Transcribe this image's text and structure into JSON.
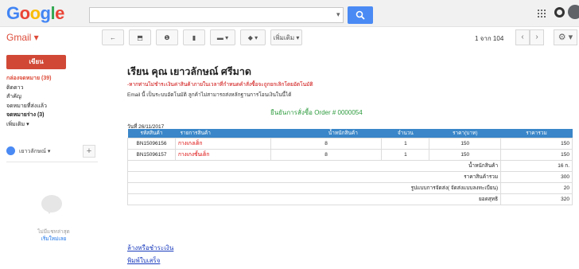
{
  "logo": {
    "letters": [
      "G",
      "o",
      "o",
      "g",
      "l",
      "e"
    ],
    "colors": [
      "#4285f4",
      "#ea4335",
      "#fbbc05",
      "#4285f4",
      "#34a853",
      "#ea4335"
    ]
  },
  "header": {
    "search_value": ""
  },
  "gmail_label": "Gmail ▾",
  "toolbar": {
    "buttons": [
      "←",
      "⬒",
      "❶",
      "▮",
      "▬ ▾",
      "◆ ▾",
      "เพิ่มเติม ▾"
    ]
  },
  "pager": {
    "text": "1 จาก 104",
    "prev": "‹",
    "next": "›",
    "settings": "⚙ ▾"
  },
  "sidebar": {
    "compose": "เขียน",
    "items": [
      {
        "label": "กล่องจดหมาย (39)",
        "state": "active"
      },
      {
        "label": "ติดดาว",
        "state": "normal"
      },
      {
        "label": "สำคัญ",
        "state": "normal"
      },
      {
        "label": "จดหมายที่ส่งแล้ว",
        "state": "normal"
      },
      {
        "label": "จดหมายร่าง (3)",
        "state": "bold"
      },
      {
        "label": "เพิ่มเติม ▾",
        "state": "normal"
      }
    ],
    "hangout_user": "เยาวลักษณ์ ▾",
    "hangout_text": "ไม่มีแชทล่าสุด",
    "hangout_link": "เริ่มใหม่เลย"
  },
  "email": {
    "subject": "เรียน คุณ เยาวลักษณ์ ศรีมาด",
    "notice": "-หากท่านไม่ชำระเงินค่าสินค้าภายในเวลาที่กำหนดคำสั่งซื้อจะถูกยกเลิกโดยอัตโนมัติ",
    "email_line": "Email นี้ เป็นระบบอัตโนมัติ ลูกค้าไม่สามารถส่งหลักฐานการโอนเงินในนี้ได้",
    "confirm": "ยืนยันการสั่งซื้อ Order # 0000054",
    "date": "วันที่ 26/11/2017"
  },
  "table": {
    "headers": [
      "รหัสสินค้า",
      "รายการสินค้า",
      "น้ำหนักสินค้า",
      "จำนวน",
      "ราคา(บาท)",
      "ราคารวม"
    ],
    "rows": [
      [
        "BN15096156",
        "กางเกงเด็ก",
        "8",
        "1",
        "150",
        "150"
      ],
      [
        "BN15096157",
        "กางเกงชั้นเด็ก",
        "8",
        "1",
        "150",
        "150"
      ]
    ],
    "summary": [
      {
        "label": "น้ำหนักสินค้า",
        "value": "16 ก."
      },
      {
        "label": "ราคาสินค้ารวม",
        "value": "300"
      },
      {
        "label": "รูปแบบการจัดส่ง( จัดส่งแบบลงทะเบียน)",
        "value": "20"
      },
      {
        "label": "ยอดสุทธิ",
        "value": "320"
      }
    ]
  },
  "links": {
    "payment": "ล้างหรือชำระเงิน",
    "print": "พิมพ์ใบเสร็จ"
  }
}
